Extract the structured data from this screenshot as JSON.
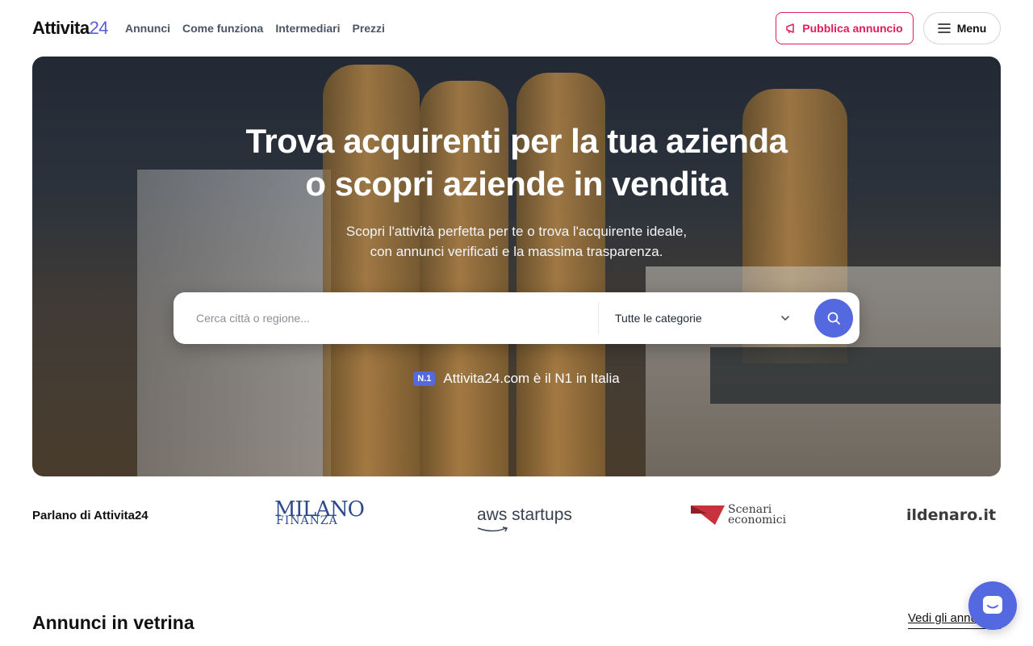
{
  "header": {
    "logo_text": "Attivita",
    "logo_num": "24",
    "nav": [
      "Annunci",
      "Come funziona",
      "Intermediari",
      "Prezzi"
    ],
    "publish_label": "Pubblica annuncio",
    "menu_label": "Menu"
  },
  "hero": {
    "title_line1": "Trova acquirenti per la tua azienda",
    "title_line2": "o scopri aziende in vendita",
    "subtitle_line1": "Scopri l'attività perfetta per te o trova l'acquirente ideale,",
    "subtitle_line2": "con annunci verificati e la massima trasparenza.",
    "search_placeholder": "Cerca città o regione...",
    "category_value": "Tutte le categorie",
    "badge": "N.1",
    "badge_text": "Attivita24.com è il N1 in Italia"
  },
  "press": {
    "label": "Parlano di Attivita24",
    "logos": {
      "milano_finanza_a": "MILANO",
      "milano_finanza_b": "FINANZA",
      "aws": "aws startups",
      "scenari_a": "Scenari",
      "scenari_b": "economici",
      "ildenaro": "ildenaro.it"
    }
  },
  "section": {
    "title": "Annunci in vetrina",
    "see_all": "Vedi gli annunci"
  },
  "colors": {
    "accent": "#5468e0",
    "publish": "#e11d5a"
  }
}
